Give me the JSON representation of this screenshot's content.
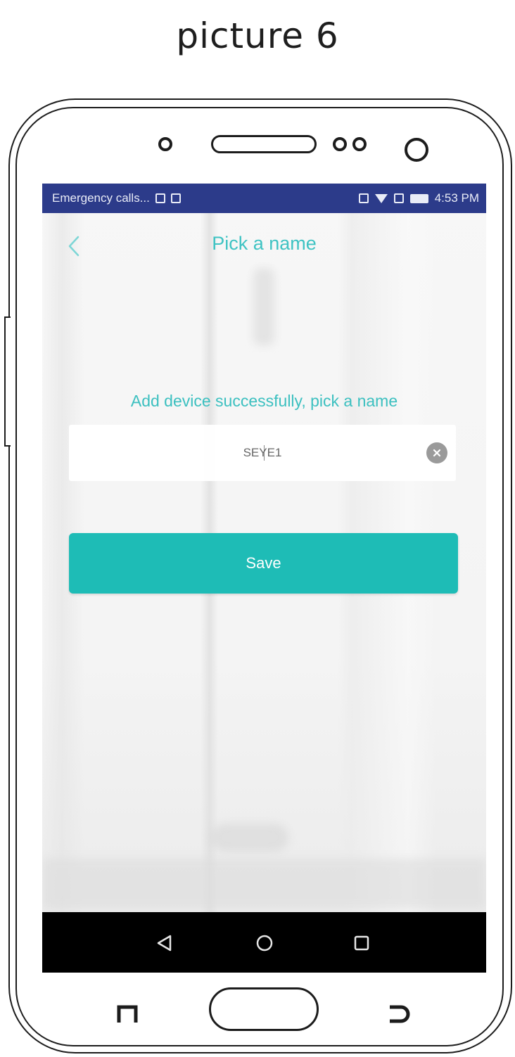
{
  "caption": "picture 6",
  "status_bar": {
    "carrier_text": "Emergency calls...",
    "time": "4:53 PM",
    "background_color": "#2c3b8a"
  },
  "header": {
    "title": "Pick a name",
    "back_icon": "chevron-left-icon"
  },
  "main": {
    "prompt": "Add device successfully, pick a name",
    "name_input": {
      "value": "SEYE1",
      "clear_icon": "clear-circle-icon"
    },
    "save_label": "Save"
  },
  "nav_bar": {
    "buttons": [
      "back-triangle-icon",
      "home-circle-icon",
      "recents-square-icon"
    ]
  },
  "colors": {
    "accent": "#3fc3c3",
    "button": "#1ebcb6",
    "status_bar": "#2c3b8a"
  }
}
